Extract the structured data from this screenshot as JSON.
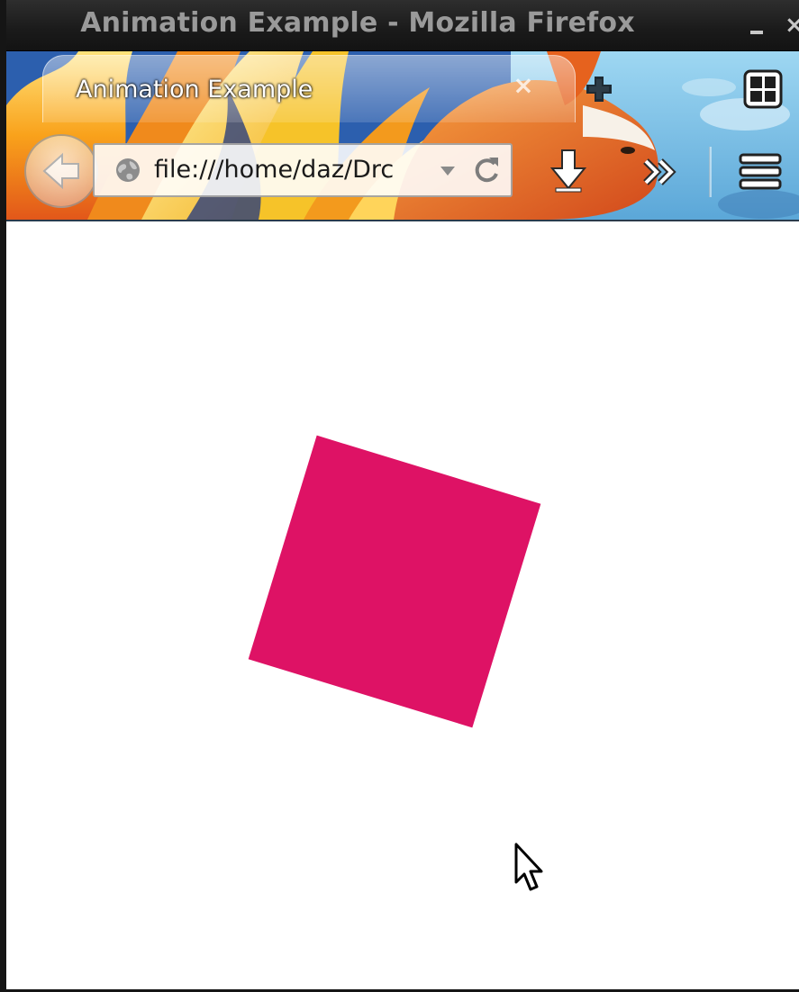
{
  "window": {
    "title": "Animation Example - Mozilla Firefox",
    "controls": {
      "minimize_icon": "minimize-icon",
      "close_icon": "close-icon",
      "close_glyph": "×"
    }
  },
  "tabs": [
    {
      "label": "Animation Example",
      "close_glyph": "×",
      "active": true
    }
  ],
  "toolbar": {
    "url": "file:///home/daz/Drc",
    "icons": {
      "back": "back-arrow-icon",
      "site_identity": "globe-icon",
      "url_dropdown": "chevron-down-icon",
      "reload": "reload-icon",
      "new_tab": "plus-icon",
      "tab_groups": "tab-groups-icon",
      "downloads": "download-arrow-icon",
      "overflow": "double-chevron-right-icon",
      "menu": "hamburger-menu-icon"
    }
  },
  "content": {
    "shape": {
      "kind": "square",
      "color": "#de1265",
      "rotation_deg": 17
    }
  },
  "colors": {
    "titlebar_bg": "#1a1a1a",
    "title_text": "#9a9a9a",
    "page_bg": "#ffffff",
    "square": "#de1265"
  }
}
